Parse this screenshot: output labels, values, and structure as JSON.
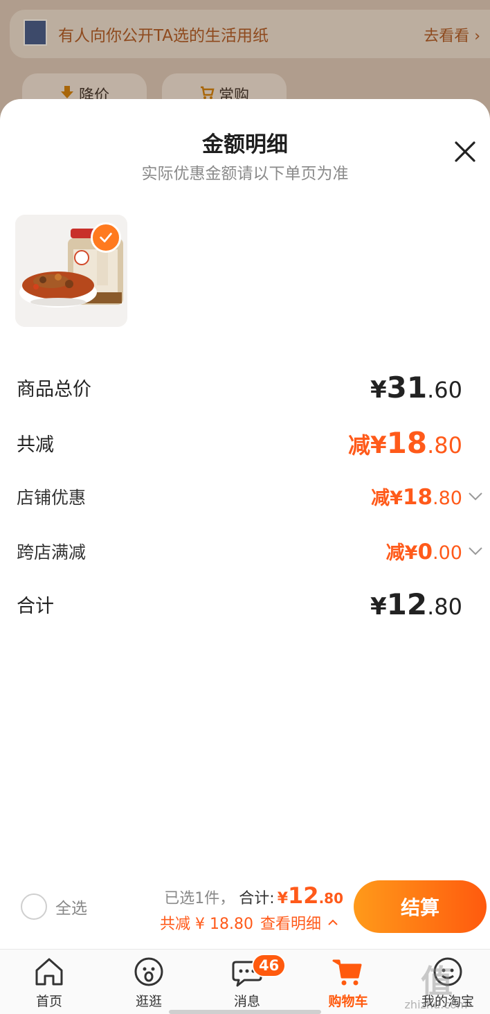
{
  "background": {
    "banner_text": "有人向你公开TA选的生活用纸",
    "banner_link": "去看看",
    "chips": [
      "降价",
      "常购"
    ]
  },
  "sheet": {
    "title": "金额明细",
    "subtitle": "实际优惠金额请以下单页为准"
  },
  "rows": {
    "goods_total": {
      "label": "商品总价",
      "currency": "¥",
      "int": "31",
      "dec": ".60"
    },
    "total_discount": {
      "label": "共减",
      "prefix": "减",
      "currency": "¥",
      "int": "18",
      "dec": ".80"
    },
    "store_discount": {
      "label": "店铺优惠",
      "prefix": "减",
      "currency": "¥",
      "int": "18",
      "dec": ".80"
    },
    "cross_store": {
      "label": "跨店满减",
      "prefix": "减",
      "currency": "¥",
      "int": "0",
      "dec": ".00"
    },
    "sum": {
      "label": "合计",
      "currency": "¥",
      "int": "12",
      "dec": ".80"
    }
  },
  "checkout": {
    "select_all": "全选",
    "selected": "已选1件，",
    "total_label": "合计:",
    "currency": "¥",
    "total_int": "12",
    "total_dec": ".80",
    "discount_text": "共减 ¥ 18.80",
    "detail_link": "查看明细",
    "button": "结算"
  },
  "tabs": [
    {
      "label": "首页"
    },
    {
      "label": "逛逛"
    },
    {
      "label": "消息",
      "badge": "46"
    },
    {
      "label": "购物车"
    },
    {
      "label": "我的淘宝"
    }
  ],
  "watermark": {
    "text": "zhizhu.com"
  },
  "colors": {
    "accent": "#ff5a0e",
    "discount": "#ff5a1a"
  }
}
